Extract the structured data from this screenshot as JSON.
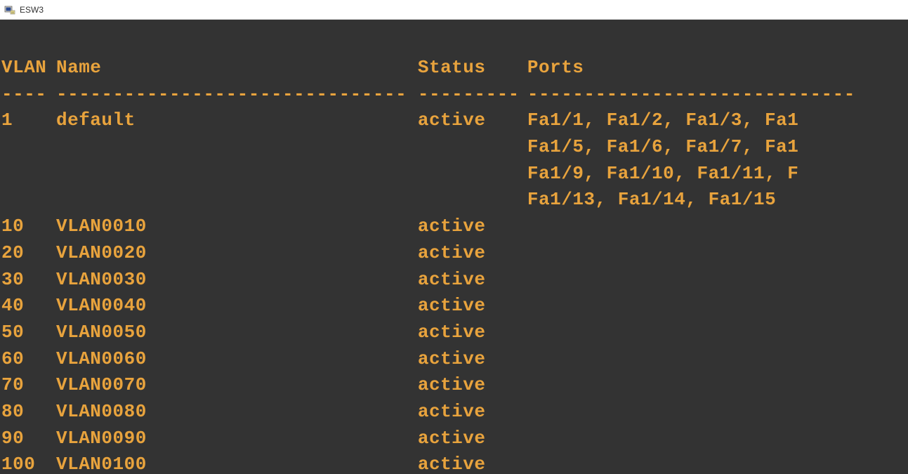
{
  "window": {
    "title": "ESW3"
  },
  "terminal": {
    "headers": {
      "vlan": "VLAN",
      "name": "Name",
      "status": "Status",
      "ports": "Ports"
    },
    "dashes": {
      "vlan": "----",
      "name": "--------------------------------",
      "status": "---------",
      "ports": "------------------------------"
    },
    "rows": [
      {
        "vlan": "1",
        "name": "default",
        "status": "active",
        "ports_lines": [
          "Fa1/1, Fa1/2, Fa1/3, Fa1",
          "Fa1/5, Fa1/6, Fa1/7, Fa1",
          "Fa1/9, Fa1/10, Fa1/11, F",
          "Fa1/13, Fa1/14, Fa1/15"
        ]
      },
      {
        "vlan": "10",
        "name": "VLAN0010",
        "status": "active",
        "ports_lines": [
          ""
        ]
      },
      {
        "vlan": "20",
        "name": "VLAN0020",
        "status": "active",
        "ports_lines": [
          ""
        ]
      },
      {
        "vlan": "30",
        "name": "VLAN0030",
        "status": "active",
        "ports_lines": [
          ""
        ]
      },
      {
        "vlan": "40",
        "name": "VLAN0040",
        "status": "active",
        "ports_lines": [
          ""
        ]
      },
      {
        "vlan": "50",
        "name": "VLAN0050",
        "status": "active",
        "ports_lines": [
          ""
        ]
      },
      {
        "vlan": "60",
        "name": "VLAN0060",
        "status": "active",
        "ports_lines": [
          ""
        ]
      },
      {
        "vlan": "70",
        "name": "VLAN0070",
        "status": "active",
        "ports_lines": [
          ""
        ]
      },
      {
        "vlan": "80",
        "name": "VLAN0080",
        "status": "active",
        "ports_lines": [
          ""
        ]
      },
      {
        "vlan": "90",
        "name": "VLAN0090",
        "status": "active",
        "ports_lines": [
          ""
        ]
      },
      {
        "vlan": "100",
        "name": "VLAN0100",
        "status": "active",
        "ports_lines": [
          ""
        ]
      }
    ]
  }
}
